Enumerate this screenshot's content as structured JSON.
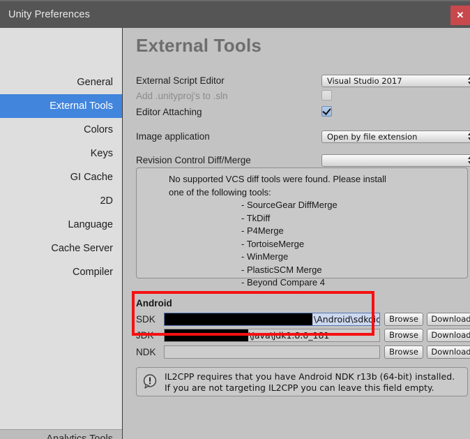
{
  "window": {
    "title": "Unity Preferences",
    "close_label": "✕",
    "close_color": "#c9484c",
    "titlebar_color": "#555555"
  },
  "sidebar": {
    "selected_color": "#4285dd",
    "items": [
      {
        "label": "General",
        "selected": false
      },
      {
        "label": "External Tools",
        "selected": true
      },
      {
        "label": "Colors",
        "selected": false
      },
      {
        "label": "Keys",
        "selected": false
      },
      {
        "label": "GI Cache",
        "selected": false
      },
      {
        "label": "2D",
        "selected": false
      },
      {
        "label": "Language",
        "selected": false
      },
      {
        "label": "Cache Server",
        "selected": false
      },
      {
        "label": "Compiler",
        "selected": false
      }
    ],
    "partial_item_label": "Analytics Tools"
  },
  "main": {
    "page_title": "External Tools",
    "script_editor": {
      "label": "External Script Editor",
      "value": "Visual Studio 2017"
    },
    "add_unityproj": {
      "label": "Add .unityproj's to .sln",
      "checked": false,
      "disabled": true
    },
    "editor_attaching": {
      "label": "Editor Attaching",
      "checked": true
    },
    "image_application": {
      "label": "Image application",
      "value": "Open by file extension"
    },
    "revision_control": {
      "label": "Revision Control Diff/Merge",
      "value": ""
    },
    "vcs_help": {
      "line1": "No supported VCS diff tools were found. Please install",
      "line2": "one of the following tools:",
      "tools": [
        "- SourceGear DiffMerge",
        "- TkDiff",
        "- P4Merge",
        "- TortoiseMerge",
        "- WinMerge",
        "- PlasticSCM Merge",
        "- Beyond Compare 4"
      ]
    },
    "android": {
      "group_title": "Android",
      "highlight_color": "#f51111",
      "rows": [
        {
          "label": "SDK",
          "value": "\\Android\\sdkoid\\s",
          "redacted": true,
          "focused": true,
          "browse_label": "Browse",
          "download_label": "Download"
        },
        {
          "label": "JDK",
          "value": "\\Java\\jdk1.8.0_181",
          "redacted": true,
          "focused": false,
          "browse_label": "Browse",
          "download_label": "Download"
        },
        {
          "label": "NDK",
          "value": "",
          "redacted": false,
          "focused": false,
          "browse_label": "Browse",
          "download_label": "Download"
        }
      ]
    },
    "ndk_info": {
      "icon": "info-exclamation-icon",
      "line1": "IL2CPP requires that you have Android NDK r13b (64-bit) installed.",
      "line2": "If you are not targeting IL2CPP you can leave this field empty."
    }
  }
}
